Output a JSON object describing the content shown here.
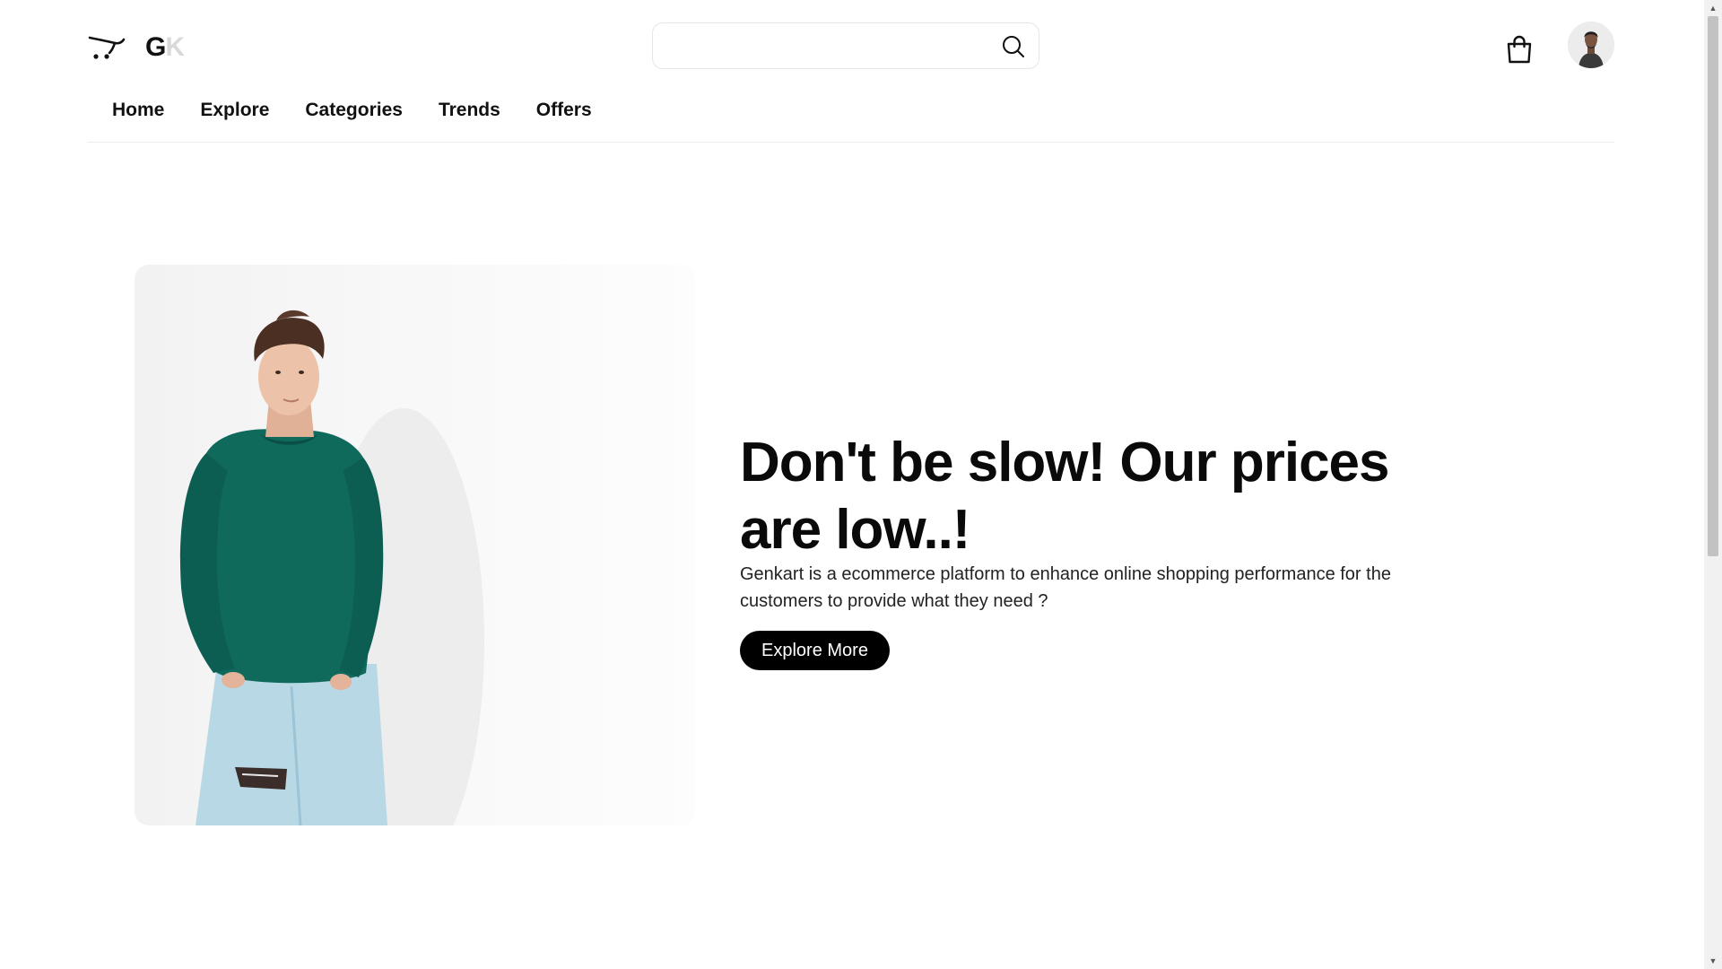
{
  "brand": {
    "logo_letter_g": "G",
    "logo_letter_k": "K"
  },
  "search": {
    "placeholder": "",
    "value": ""
  },
  "nav": {
    "items": [
      "Home",
      "Explore",
      "Categories",
      "Trends",
      "Offers"
    ]
  },
  "hero": {
    "headline": "Don't be slow! Our prices are low..!",
    "description": "Genkart is a ecommerce platform to enhance online shopping performance for the customers to provide what they need ?",
    "cta_label": "Explore More"
  },
  "icons": {
    "logo": "cart-logo-icon",
    "search": "search-icon",
    "bag": "shopping-bag-icon",
    "avatar": "user-avatar",
    "scroll_up": "scroll-up-arrow",
    "scroll_down": "scroll-down-arrow"
  },
  "colors": {
    "accent": "#000000",
    "logo_k": "#d9d9d9",
    "sweater": "#0f6a5c",
    "jeans": "#b9d8e6"
  }
}
